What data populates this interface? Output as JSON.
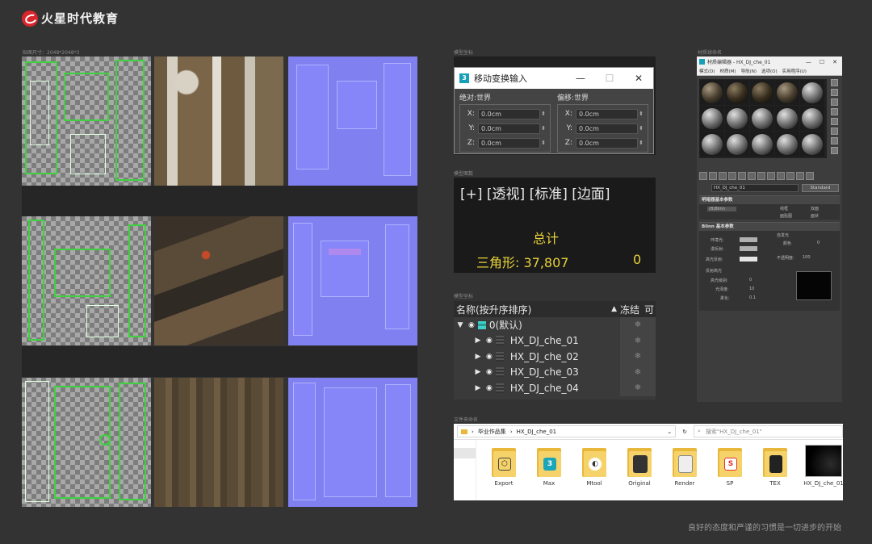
{
  "brand": {
    "logo_text": "火星时代教育"
  },
  "captions": {
    "texture": "贴图尺寸：2048*2048*3",
    "transform": "模型坐标",
    "viewport": "模型面数",
    "scene": "模型坐标",
    "material": "材质球命名",
    "files": "文件夹命名"
  },
  "transform_dialog": {
    "title": "移动变换输入",
    "buttons": {
      "minimize": "—",
      "maximize": "☐",
      "close": "✕"
    },
    "absolute": {
      "title": "绝对:世界",
      "x": "0.0cm",
      "y": "0.0cm",
      "z": "0.0cm"
    },
    "offset": {
      "title": "偏移:世界",
      "x": "0.0cm",
      "y": "0.0cm",
      "z": "0.0cm"
    },
    "axis_labels": {
      "x": "X:",
      "y": "Y:",
      "z": "Z:"
    }
  },
  "viewport": {
    "label": "[+] [透视] [标准] [边面]",
    "total_label": "总计",
    "triangles": "三角形: 37,807",
    "zero": "0"
  },
  "scene_explorer": {
    "col_name": "名称(按升序排序)",
    "col_sort": "▲",
    "col_freeze": "冻结",
    "col_extra": "可",
    "layer": "0(默认)",
    "objects": [
      "HX_DJ_che_01",
      "HX_DJ_che_02",
      "HX_DJ_che_03",
      "HX_DJ_che_04"
    ]
  },
  "material_editor": {
    "title": "材质编辑器 - HX_DJ_che_01",
    "menu": [
      "模式(D)",
      "材质(M)",
      "导航(N)",
      "选项(O)",
      "实用程序(U)"
    ],
    "material_name": "HX_DJ_che_01",
    "material_type": "Standard",
    "rollout1": "明暗器基本参数",
    "shader": "(B)Blinn",
    "options": [
      "线框",
      "双面",
      "面贴图",
      "面状"
    ],
    "rollout2": "Blinn 基本参数",
    "ambient": "环境光:",
    "diffuse": "漫反射:",
    "specular": "高光反射:",
    "self_illum": "自发光",
    "color": "颜色",
    "color_val": "0",
    "opacity": "不透明度:",
    "opacity_val": "100",
    "spec_title": "反射高光",
    "spec_level": "高光级别:",
    "spec_level_val": "0",
    "gloss": "光泽度:",
    "gloss_val": "10",
    "soften": "柔化:",
    "soften_val": "0.1"
  },
  "file_explorer": {
    "breadcrumb": [
      "毕业作品集",
      "HX_DJ_che_01"
    ],
    "search": "搜索\"HX_DJ_che_01\"",
    "items": [
      "Export",
      "Max",
      "Mtool",
      "Original",
      "Render",
      "SP",
      "TEX",
      "HX_DJ_che_01"
    ]
  },
  "footer": "良好的态度和严谨的习惯是一切进步的开始"
}
